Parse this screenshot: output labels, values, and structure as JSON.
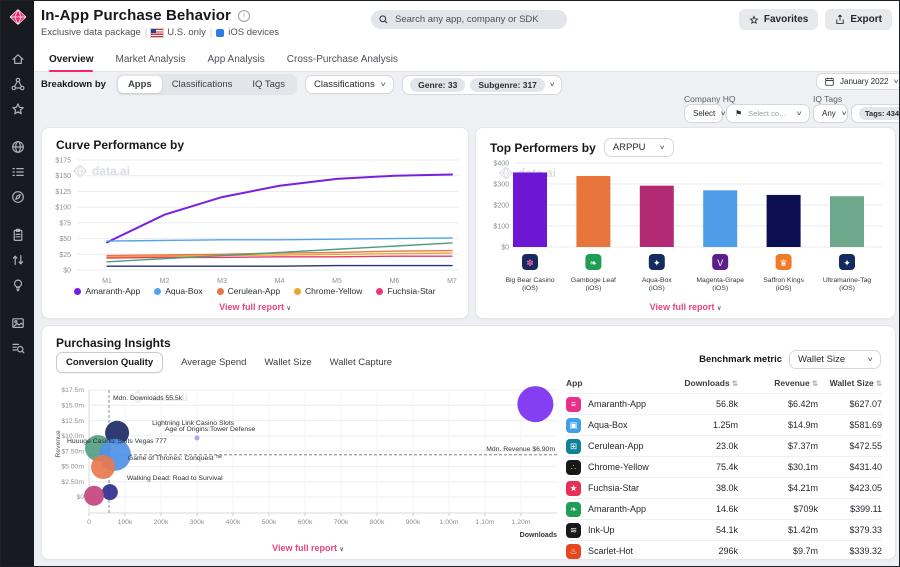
{
  "watermark": "data.ai",
  "app": {
    "title": "In-App Purchase Behavior",
    "subtitle": {
      "package": "Exclusive data package",
      "region": "U.S. only",
      "device": "iOS devices"
    }
  },
  "search": {
    "placeholder": "Search any app, company or SDK"
  },
  "actions": {
    "favorites": "Favorites",
    "export": "Export"
  },
  "nav_tabs": [
    {
      "label": "Overview",
      "active": true
    },
    {
      "label": "Market Analysis",
      "active": false
    },
    {
      "label": "App Analysis",
      "active": false
    },
    {
      "label": "Cross-Purchase Analysis",
      "active": false
    }
  ],
  "filters": {
    "breakdown_label": "Breakdown by",
    "segments": [
      "Apps",
      "Classifications",
      "IQ Tags"
    ],
    "selected_segment": "Apps",
    "classification_dropdown": "Classifications",
    "pills": [
      "Genre: 33",
      "Subgenre: 317"
    ],
    "date": "January 2022",
    "company_hq_label": "Company HQ",
    "company_hq_select": "Select",
    "company_hq_countries": "Select countries or regions",
    "iq_tags_label": "IQ Tags",
    "iq_tags_any": "Any",
    "iq_tags_count": "Tags: 434"
  },
  "sidebar": {
    "icons": [
      "home",
      "apps-network",
      "favorites-star",
      "market-globe",
      "top-charts-list",
      "engagement-compass",
      "reports-clipboard",
      "compare-arrows",
      "insights-bulb",
      "media-image",
      "search-list"
    ],
    "groups": [
      3,
      3,
      3,
      2
    ]
  },
  "curve_card": {
    "title": "Curve Performance by",
    "view_link": "View full report"
  },
  "top_card": {
    "title": "Top Performers by",
    "metric": "ARPPU",
    "view_link": "View full report"
  },
  "insights": {
    "title": "Purchasing Insights",
    "tabs": [
      "Conversion Quality",
      "Average Spend",
      "Wallet Size",
      "Wallet Capture"
    ],
    "selected_tab": "Conversion Quality",
    "benchmark_label": "Benchmark metric",
    "benchmark_value": "Wallet Size",
    "view_link": "View full report",
    "table": {
      "headers": [
        {
          "label": "App",
          "sortable": false
        },
        {
          "label": "Downloads",
          "sortable": true
        },
        {
          "label": "Revenue",
          "sortable": true
        },
        {
          "label": "Wallet Size",
          "sortable": true
        }
      ],
      "rows": [
        {
          "app": "Amaranth-App",
          "icon": {
            "bg": "#e8308a",
            "glyph": "≡",
            "color": "#ffffff"
          },
          "downloads": "56.8k",
          "revenue": "$6.42m",
          "wallet_size": "$627.07"
        },
        {
          "app": "Aqua-Box",
          "icon": {
            "bg": "#3fa0e8",
            "glyph": "▣",
            "color": "#ffffff"
          },
          "downloads": "1.25m",
          "revenue": "$14.9m",
          "wallet_size": "$581.69"
        },
        {
          "app": "Cerulean-App",
          "icon": {
            "bg": "#0f8296",
            "glyph": "⊞",
            "color": "#ffffff"
          },
          "downloads": "23.0k",
          "revenue": "$7.37m",
          "wallet_size": "$472.55"
        },
        {
          "app": "Chrome-Yellow",
          "icon": {
            "bg": "#17181c",
            "glyph": "∴",
            "color": "#f5c518"
          },
          "downloads": "75.4k",
          "revenue": "$30.1m",
          "wallet_size": "$431.40"
        },
        {
          "app": "Fuchsia-Star",
          "icon": {
            "bg": "#e82f55",
            "glyph": "★",
            "color": "#ffffff"
          },
          "downloads": "38.0k",
          "revenue": "$4.21m",
          "wallet_size": "$423.05"
        },
        {
          "app": "Amaranth-App",
          "icon": {
            "bg": "#1f9d55",
            "glyph": "❧",
            "color": "#ffffff"
          },
          "downloads": "14.6k",
          "revenue": "$709k",
          "wallet_size": "$399.11"
        },
        {
          "app": "Ink-Up",
          "icon": {
            "bg": "#17181c",
            "glyph": "≋",
            "color": "#ffffff"
          },
          "downloads": "54.1k",
          "revenue": "$1.42m",
          "wallet_size": "$379.33"
        },
        {
          "app": "Scarlet-Hot",
          "icon": {
            "bg": "#e8461f",
            "glyph": "♨",
            "color": "#ffffff"
          },
          "downloads": "296k",
          "revenue": "$9.7m",
          "wallet_size": "$339.32"
        }
      ]
    }
  },
  "chart_data": [
    {
      "type": "line",
      "title": "Curve Performance by",
      "x": [
        "M1",
        "M2",
        "M3",
        "M4",
        "M5",
        "M6",
        "M7"
      ],
      "yticks": [
        0,
        25,
        50,
        75,
        100,
        125,
        150,
        175
      ],
      "ytick_labels": [
        "$0",
        "$25",
        "$50",
        "$75",
        "$100",
        "$125",
        "$150",
        "$175"
      ],
      "ylim": [
        0,
        175
      ],
      "legend_position": "bottom",
      "series": [
        {
          "name": "Amaranth-App",
          "color": "#7a1fe0",
          "width": 2,
          "values": [
            44,
            88,
            116,
            134,
            145,
            150,
            152
          ],
          "legend": true
        },
        {
          "name": "Aqua-Box",
          "color": "#54a4ea",
          "width": 1.4,
          "values": [
            46,
            47,
            48,
            48,
            49,
            50,
            51
          ],
          "legend": true
        },
        {
          "name": "Cerulean-App",
          "color": "#e8754a",
          "width": 1.4,
          "values": [
            23,
            24,
            25,
            27,
            28,
            30,
            31
          ],
          "legend": true
        },
        {
          "name": "Chrome-Yellow",
          "color": "#f0a42c",
          "width": 1.4,
          "values": [
            21,
            22,
            23,
            24,
            25,
            26,
            27
          ],
          "legend": true
        },
        {
          "name": "Fuchsia-Star",
          "color": "#e83a72",
          "width": 1.4,
          "values": [
            19,
            20,
            20,
            21,
            21,
            22,
            22
          ],
          "legend": true
        },
        {
          "name": "unlabeled-green",
          "color": "#4d9e7c",
          "width": 1.4,
          "values": [
            13,
            18,
            23,
            28,
            33,
            38,
            43
          ],
          "legend": false
        },
        {
          "name": "unlabeled-navy",
          "color": "#2b3280",
          "width": 1.4,
          "values": [
            6,
            6,
            6,
            6,
            7,
            7,
            7
          ],
          "legend": false
        }
      ]
    },
    {
      "type": "bar",
      "title": "Top Performers by ARPPU",
      "categories": [
        "Big Bear Casino (iOS)",
        "Gamboge Leaf (iOS)",
        "Aqua-Box (iOS)",
        "Magenta-Grape (iOS)",
        "Saffron Kings (iOS)",
        "Ultramarine-Tag (iOS)"
      ],
      "values": [
        355,
        338,
        292,
        270,
        248,
        242
      ],
      "colors": [
        "#6d16d4",
        "#e8763c",
        "#b22b72",
        "#4f9ce8",
        "#0c0e52",
        "#6ea98d"
      ],
      "icons": [
        {
          "bg": "#152a5e",
          "glyph": "✽",
          "color": "#e85a9b"
        },
        {
          "bg": "#1f9d55",
          "glyph": "❧",
          "color": "#ffffff"
        },
        {
          "bg": "#152a5e",
          "glyph": "✦",
          "color": "#ffffff"
        },
        {
          "bg": "#5b1f8a",
          "glyph": "V",
          "color": "#ffffff"
        },
        {
          "bg": "#f07a28",
          "glyph": "♛",
          "color": "#ffffff"
        },
        {
          "bg": "#152a5e",
          "glyph": "✦",
          "color": "#ffffff"
        }
      ],
      "ytick_labels": [
        "$0",
        "$100",
        "$200",
        "$300",
        "$400"
      ],
      "ylim": [
        0,
        400
      ]
    },
    {
      "type": "scatter",
      "xlabel": "Downloads",
      "ylabel": "Revenue",
      "xlim": [
        0,
        1300000
      ],
      "xticks": [
        {
          "v": 0,
          "label": "0"
        },
        {
          "v": 100000,
          "label": "100k"
        },
        {
          "v": 200000,
          "label": "200k"
        },
        {
          "v": 300000,
          "label": "300k"
        },
        {
          "v": 400000,
          "label": "400k"
        },
        {
          "v": 500000,
          "label": "500k"
        },
        {
          "v": 600000,
          "label": "600k"
        },
        {
          "v": 700000,
          "label": "700k"
        },
        {
          "v": 800000,
          "label": "800k"
        },
        {
          "v": 900000,
          "label": "900k"
        },
        {
          "v": 1000000,
          "label": "1.00m"
        },
        {
          "v": 1100000,
          "label": "1.10m"
        },
        {
          "v": 1200000,
          "label": "1.20m"
        }
      ],
      "yticks": [
        {
          "v": 0,
          "label": "$0"
        },
        {
          "v": 2500000,
          "label": "$2.50m"
        },
        {
          "v": 5000000,
          "label": "$5.00m"
        },
        {
          "v": 7500000,
          "label": "$7.50m"
        },
        {
          "v": 10000000,
          "label": "$10.0m"
        },
        {
          "v": 12500000,
          "label": "$12.5m"
        },
        {
          "v": 15000000,
          "label": "$15.0m"
        },
        {
          "v": 17500000,
          "label": "$17.5m"
        }
      ],
      "median_x": {
        "value": 55500,
        "label": "Mdn. Downloads 55.5k"
      },
      "median_y": {
        "value": 6900000,
        "label": "Mdn. Revenue $6.90m"
      },
      "points": [
        {
          "label": "",
          "x": 1240000,
          "y": 15200000,
          "r": 18,
          "color": "#7b2ff2",
          "ldx": 0,
          "ldy": 0
        },
        {
          "label": "Lightning Link Casino Slots",
          "x": 78000,
          "y": 10500000,
          "r": 12,
          "color": "#1d2a66",
          "ldx": 35,
          "ldy": -8
        },
        {
          "label": "Age of Origins:Tower Defense",
          "x": 300000,
          "y": 9650000,
          "r": 2.5,
          "color": "#b49ae8",
          "ldx": -32,
          "ldy": -7
        },
        {
          "label": "Huuuge Casino: Slots Vegas 777",
          "x": 25000,
          "y": 8000000,
          "r": 13,
          "color": "#55a081",
          "ldx": -31,
          "ldy": -5
        },
        {
          "label": "Game of Thrones: Conquest ™",
          "x": 72000,
          "y": 6900000,
          "r": 16,
          "color": "#4f93e8",
          "ldx": 13,
          "ldy": 5
        },
        {
          "label": "",
          "x": 39000,
          "y": 4900000,
          "r": 12,
          "color": "#e8784e",
          "ldx": 0,
          "ldy": 0
        },
        {
          "label": "Walking Dead: Road to Survival",
          "x": 58000,
          "y": 800000,
          "r": 8,
          "color": "#30308e",
          "ldx": 17,
          "ldy": -12
        },
        {
          "label": "",
          "x": 14000,
          "y": 200000,
          "r": 10,
          "color": "#c2447e",
          "ldx": 0,
          "ldy": 0
        }
      ]
    }
  ]
}
